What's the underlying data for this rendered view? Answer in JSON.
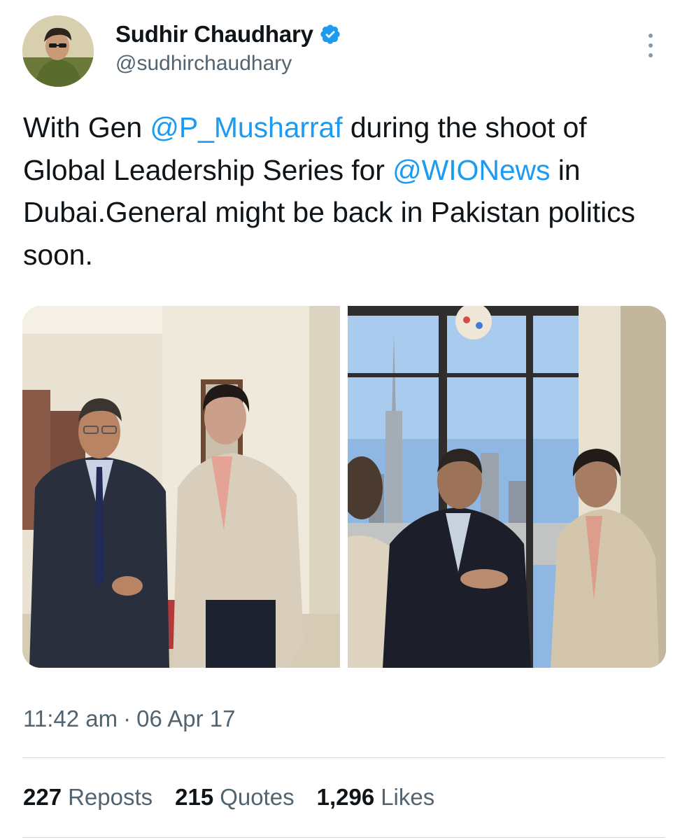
{
  "author": {
    "display_name": "Sudhir Chaudhary",
    "handle": "@sudhirchaudhary",
    "verified": true,
    "verified_color": "#1d9bf0"
  },
  "tweet": {
    "text_parts": [
      {
        "text": "With Gen ",
        "type": "text"
      },
      {
        "text": "@P_Musharraf",
        "type": "mention"
      },
      {
        "text": " during the shoot of Global Leadership Series for ",
        "type": "text"
      },
      {
        "text": "@WIONews",
        "type": "mention"
      },
      {
        "text": " in Dubai.General might be back in Pakistan politics soon.",
        "type": "text"
      }
    ],
    "time": "11:42 am",
    "separator": "·",
    "date": "06 Apr 17"
  },
  "stats": {
    "reposts_count": "227",
    "reposts_label": "Reposts",
    "quotes_count": "215",
    "quotes_label": "Quotes",
    "likes_count": "1,296",
    "likes_label": "Likes"
  },
  "icons": {
    "verified": "verified-badge-icon",
    "more": "more-options-icon"
  },
  "colors": {
    "link": "#1d9bf0",
    "secondary_text": "#536471",
    "primary_text": "#0f1419"
  }
}
